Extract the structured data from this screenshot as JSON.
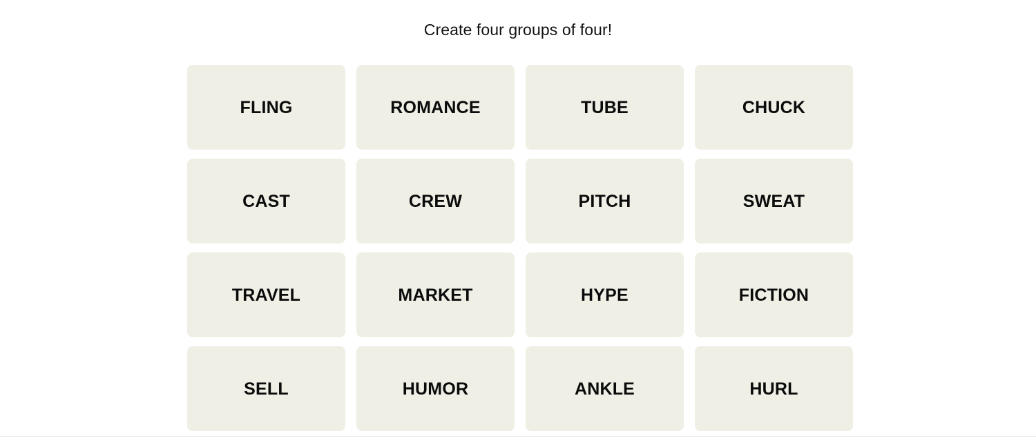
{
  "header": {
    "title": "Create four groups of four!"
  },
  "board": {
    "rows": [
      [
        "FLING",
        "ROMANCE",
        "TUBE",
        "CHUCK"
      ],
      [
        "CAST",
        "CREW",
        "PITCH",
        "SWEAT"
      ],
      [
        "TRAVEL",
        "MARKET",
        "HYPE",
        "FICTION"
      ],
      [
        "SELL",
        "HUMOR",
        "ANKLE",
        "HURL"
      ]
    ],
    "tiles": [
      "FLING",
      "ROMANCE",
      "TUBE",
      "CHUCK",
      "CAST",
      "CREW",
      "PITCH",
      "SWEAT",
      "TRAVEL",
      "MARKET",
      "HYPE",
      "FICTION",
      "SELL",
      "HUMOR",
      "ANKLE",
      "HURL"
    ]
  },
  "colors": {
    "page_background": "#FFFFFF",
    "tile_background": "#EFEFE6",
    "tile_text": "#0B0B0B",
    "title_text": "#121212",
    "rule": "#E8E8E8"
  }
}
